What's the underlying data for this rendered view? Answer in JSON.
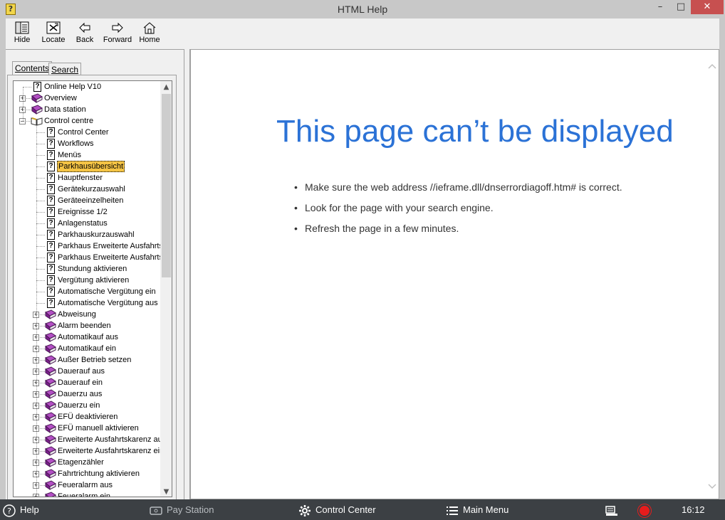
{
  "window": {
    "title": "HTML Help",
    "icon": "help-book-icon",
    "controls": {
      "minimize": "–",
      "maximize": "□",
      "close": "✕"
    }
  },
  "toolbar": {
    "buttons": [
      {
        "label": "Hide",
        "icon": "hide-pane-icon"
      },
      {
        "label": "Locate",
        "icon": "locate-icon"
      },
      {
        "label": "Back",
        "icon": "back-arrow-icon"
      },
      {
        "label": "Forward",
        "icon": "forward-arrow-icon"
      },
      {
        "label": "Home",
        "icon": "home-icon"
      }
    ]
  },
  "nav": {
    "tabs": [
      {
        "label": "Contents",
        "active": true
      },
      {
        "label": "Search",
        "active": false
      }
    ],
    "tree": [
      {
        "label": "Online Help V10",
        "type": "page",
        "level": 0
      },
      {
        "label": "Overview",
        "type": "book",
        "level": 0,
        "expander": "+"
      },
      {
        "label": "Data station",
        "type": "book",
        "level": 0,
        "expander": "+"
      },
      {
        "label": "Control centre",
        "type": "book-open",
        "level": 0,
        "expander": "–"
      },
      {
        "label": "Control Center",
        "type": "page",
        "level": 1
      },
      {
        "label": "Workflows",
        "type": "page",
        "level": 1
      },
      {
        "label": "Menüs",
        "type": "page",
        "level": 1
      },
      {
        "label": "Parkhausübersicht",
        "type": "page",
        "level": 1,
        "selected": true
      },
      {
        "label": "Hauptfenster",
        "type": "page",
        "level": 1
      },
      {
        "label": "Gerätekurzauswahl",
        "type": "page",
        "level": 1
      },
      {
        "label": "Geräteeinzelheiten",
        "type": "page",
        "level": 1
      },
      {
        "label": "Ereignisse 1/2",
        "type": "page",
        "level": 1
      },
      {
        "label": "Anlagenstatus",
        "type": "page",
        "level": 1
      },
      {
        "label": "Parkhauskurzauswahl",
        "type": "page",
        "level": 1
      },
      {
        "label": "Parkhaus Erweiterte Ausfahrts",
        "type": "page",
        "level": 1
      },
      {
        "label": "Parkhaus Erweiterte Ausfahrts",
        "type": "page",
        "level": 1
      },
      {
        "label": "Stundung aktivieren",
        "type": "page",
        "level": 1
      },
      {
        "label": "Vergütung aktivieren",
        "type": "page",
        "level": 1
      },
      {
        "label": "Automatische Vergütung ein",
        "type": "page",
        "level": 1
      },
      {
        "label": "Automatische Vergütung aus",
        "type": "page",
        "level": 1
      },
      {
        "label": "Abweisung",
        "type": "book",
        "level": 1,
        "expander": "+"
      },
      {
        "label": "Alarm beenden",
        "type": "book",
        "level": 1,
        "expander": "+"
      },
      {
        "label": "Automatikauf aus",
        "type": "book",
        "level": 1,
        "expander": "+"
      },
      {
        "label": "Automatikauf ein",
        "type": "book",
        "level": 1,
        "expander": "+"
      },
      {
        "label": "Außer Betrieb setzen",
        "type": "book",
        "level": 1,
        "expander": "+"
      },
      {
        "label": "Dauerauf aus",
        "type": "book",
        "level": 1,
        "expander": "+"
      },
      {
        "label": "Dauerauf ein",
        "type": "book",
        "level": 1,
        "expander": "+"
      },
      {
        "label": "Dauerzu aus",
        "type": "book",
        "level": 1,
        "expander": "+"
      },
      {
        "label": "Dauerzu ein",
        "type": "book",
        "level": 1,
        "expander": "+"
      },
      {
        "label": "EFÜ deaktivieren",
        "type": "book",
        "level": 1,
        "expander": "+"
      },
      {
        "label": "EFÜ manuell aktivieren",
        "type": "book",
        "level": 1,
        "expander": "+"
      },
      {
        "label": "Erweiterte Ausfahrtskarenz au",
        "type": "book",
        "level": 1,
        "expander": "+"
      },
      {
        "label": "Erweiterte Ausfahrtskarenz eir",
        "type": "book",
        "level": 1,
        "expander": "+"
      },
      {
        "label": "Etagenzähler",
        "type": "book",
        "level": 1,
        "expander": "+"
      },
      {
        "label": "Fahrtrichtung aktivieren",
        "type": "book",
        "level": 1,
        "expander": "+"
      },
      {
        "label": "Feueralarm aus",
        "type": "book",
        "level": 1,
        "expander": "+"
      },
      {
        "label": "Feueralarm ein",
        "type": "book",
        "level": 1,
        "expander": "+"
      }
    ]
  },
  "content": {
    "title": "This page can’t be displayed",
    "bullets": [
      "Make sure the web address //ieframe.dll/dnserrordiagoff.htm# is correct.",
      "Look for the page with your search engine.",
      "Refresh the page in a few minutes."
    ],
    "title_color": "#2b72d6"
  },
  "taskbar": {
    "help": "Help",
    "pay_station": "Pay Station",
    "control_center": "Control Center",
    "main_menu": "Main Menu",
    "clock": "16:12",
    "record_color": "#e81c1c"
  }
}
